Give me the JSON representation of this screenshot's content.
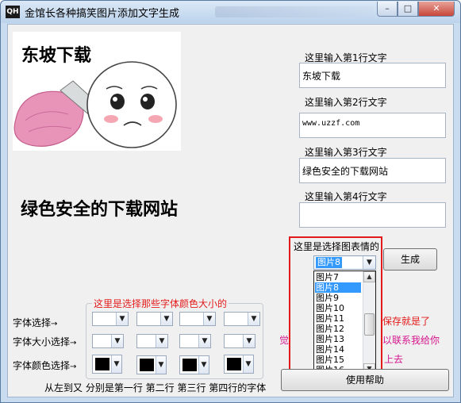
{
  "window": {
    "title": "金馆长各种搞笑图片添加文字生成",
    "app_icon_text": "QH",
    "controls": {
      "minimize": "–",
      "maximize": "□",
      "close": "✕"
    }
  },
  "preview": {
    "caption_line1": "东坡下载",
    "image_description": "cartoon face character holding a knife with pink fabric"
  },
  "main_caption": "绿色安全的下载网站",
  "text_inputs": [
    {
      "label": "这里输入第1行文字",
      "value": "东坡下载"
    },
    {
      "label": "这里输入第2行文字",
      "value": "www.uzzf.com"
    },
    {
      "label": "这里输入第3行文字",
      "value": "绿色安全的下载网站"
    },
    {
      "label": "这里输入第4行文字",
      "value": ""
    }
  ],
  "emoji_select": {
    "label": "这里是选择图表情的",
    "selected": "图片8",
    "list_items": [
      "图片7",
      "图片8",
      "图片9",
      "图片10",
      "图片11",
      "图片12",
      "图片13",
      "图片14",
      "图片15",
      "图片16"
    ],
    "highlighted": "图片8"
  },
  "buttons": {
    "generate": "生成",
    "help": "使用帮助"
  },
  "font_group": {
    "title": "这里是选择那些字体颜色大小的",
    "row_labels": [
      "字体选择",
      "字体大小选择",
      "字体颜色选择"
    ],
    "arrow": "→",
    "color": "#000000",
    "bottom_caption": "从左到又  分别是第一行  第二行  第三行  第四行的字体"
  },
  "partially_hidden_text": {
    "line1_left": "生成",
    "line1_right": "保存就是了",
    "line2_left": "觉得图片",
    "line2_right": "以联系我给你",
    "line3_right": "上去"
  },
  "colors": {
    "highlight": "#3399ff",
    "red": "#e31a1a",
    "magenta": "#d5158d"
  }
}
